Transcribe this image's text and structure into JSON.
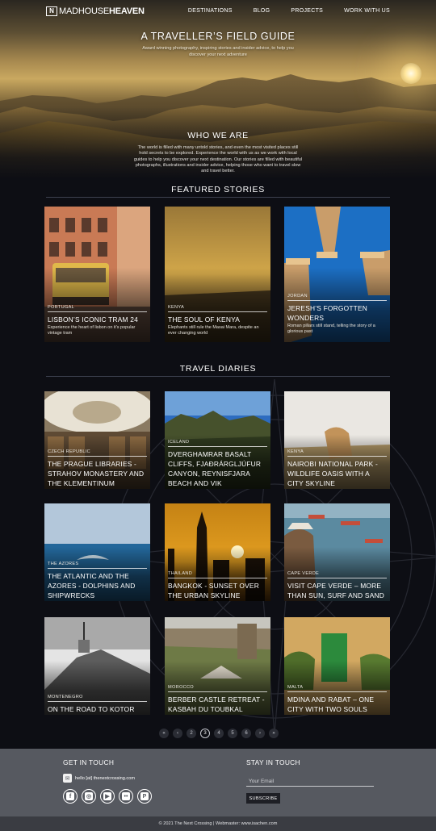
{
  "brand": {
    "logo_mark": "N",
    "name_bold": "MADHOUSE",
    "name_rest": "HEAVEN"
  },
  "nav": [
    {
      "label": "DESTINATIONS"
    },
    {
      "label": "BLOG"
    },
    {
      "label": "PROJECTS"
    },
    {
      "label": "WORK WITH US"
    }
  ],
  "hero": {
    "title": "A TRAVELLER’S FIELD GUIDE",
    "subtitle": "Award winning photography, inspiring stories and insider advice, to help you discover your next adventure"
  },
  "who_we_are": {
    "title": "WHO WE ARE",
    "text": "The world is filled with many untold stories, and even the most visited places still hold secrets to be explored. Experience the world with us as we work with local guides to help you discover your next destination. Our stories are filled with beautiful photographs, illustrations and insider advice, helping those who want to travel slow and travel better."
  },
  "featured": {
    "title": "FEATURED STORIES",
    "items": [
      {
        "country": "PORTUGAL",
        "title": "LISBON’S ICONIC TRAM 24",
        "desc": "Experience the heart of lisbon on it's popular vintage tram"
      },
      {
        "country": "KENYA",
        "title": "THE SOUL OF KENYA",
        "desc": "Elephants still rule the Masai Mara, despite an ever changing world"
      },
      {
        "country": "JORDAN",
        "title": "JERESH’S FORGOTTEN WONDERS",
        "desc": "Roman pillars still stand, telling the story of a glorious past"
      }
    ]
  },
  "diaries": {
    "title": "TRAVEL DIARIES",
    "items": [
      {
        "country": "CZECH REPUBLIC",
        "title": "THE PRAGUE LIBRARIES - STRAHOV MONASTERY AND THE KLEMENTINUM"
      },
      {
        "country": "ICELAND",
        "title": "DVERGHAMRAR BASALT CLIFFS, FJAÐRÁRGLJÚFUR CANYON, REYNISFJARA BEACH AND VIK"
      },
      {
        "country": "KENYA",
        "title": "NAIROBI NATIONAL PARK - WILDLIFE OASIS WITH A CITY SKYLINE"
      },
      {
        "country": "THE AZORES",
        "title": "THE ATLANTIC AND THE AZORES - DOLPHINS AND SHIPWRECKS"
      },
      {
        "country": "THAILAND",
        "title": "BANGKOK - SUNSET OVER THE URBAN SKYLINE"
      },
      {
        "country": "CAPE VERDE",
        "title": "VISIT CAPE VERDE – MORE THAN SUN, SURF AND SAND"
      },
      {
        "country": "MONTENEGRO",
        "title": "ON THE ROAD TO KOTOR"
      },
      {
        "country": "MOROCCO",
        "title": "BERBER CASTLE RETREAT - KASBAH DU TOUBKAL"
      },
      {
        "country": "MALTA",
        "title": "MDINA AND RABAT – ONE CITY WITH TWO SOULS"
      }
    ]
  },
  "pagination": {
    "first": "«",
    "prev": "‹",
    "pages": [
      "2",
      "3",
      "4",
      "5",
      "6"
    ],
    "current": "3",
    "next": "›",
    "last": "»"
  },
  "footer": {
    "contact_title": "GET IN TOUCH",
    "email_text": "hello [at] thenextcrossing.com",
    "socials": [
      {
        "icon": "facebook-icon",
        "glyph": "f"
      },
      {
        "icon": "instagram-icon",
        "glyph": "◎"
      },
      {
        "icon": "youtube-icon",
        "glyph": "▶"
      },
      {
        "icon": "flickr-icon",
        "glyph": "••"
      },
      {
        "icon": "pinterest-icon",
        "glyph": "P"
      }
    ],
    "newsletter_title": "STAY IN TOUCH",
    "email_placeholder": "Your Email",
    "subscribe_label": "SUBSCRIBE",
    "copyright": "© 2021 The Next Crossing | Webmaster: www.isachen.com"
  },
  "colors": {
    "background": "#0d0e14",
    "footer": "#565960",
    "footer_bottom": "#3a3c42",
    "rule": "#3d4150"
  }
}
